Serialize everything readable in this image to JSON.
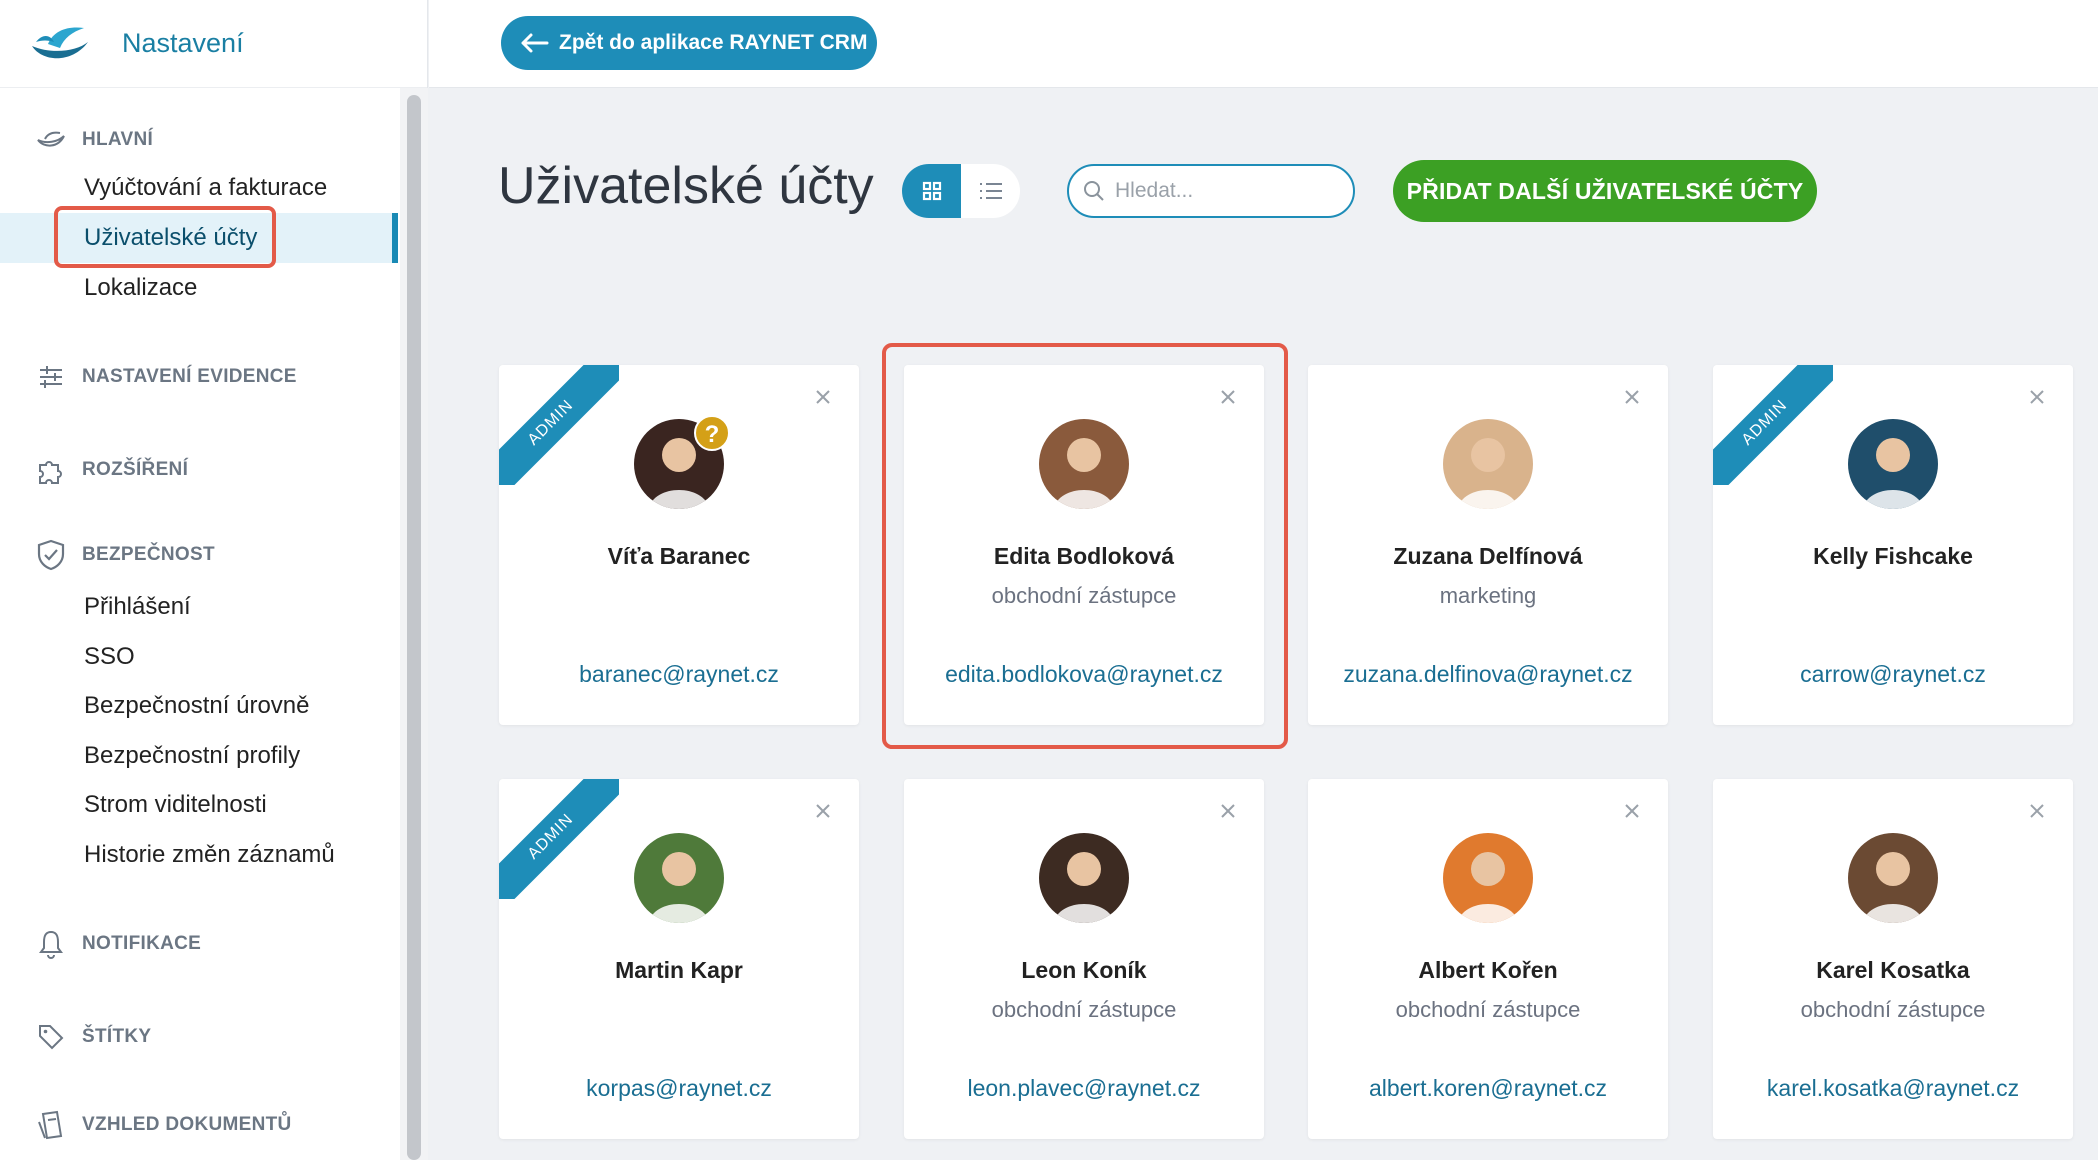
{
  "app": {
    "title": "Nastavení"
  },
  "topbar": {
    "back_label": "Zpět do aplikace RAYNET CRM"
  },
  "sidebar": {
    "sections": [
      {
        "label": "HLAVNÍ",
        "icon": "raynet-logo-icon"
      },
      {
        "label": "NASTAVENÍ EVIDENCE",
        "icon": "sliders-icon"
      },
      {
        "label": "ROZŠÍŘENÍ",
        "icon": "puzzle-icon"
      },
      {
        "label": "BEZPEČNOST",
        "icon": "shield-check-icon"
      },
      {
        "label": "NOTIFIKACE",
        "icon": "bell-icon"
      },
      {
        "label": "ŠTÍTKY",
        "icon": "tag-icon"
      },
      {
        "label": "VZHLED DOKUMENTŮ",
        "icon": "document-style-icon"
      }
    ],
    "main_items": [
      "Vyúčtování a fakturace",
      "Uživatelské účty",
      "Lokalizace"
    ],
    "security_items": [
      "Přihlášení",
      "SSO",
      "Bezpečnostní úrovně",
      "Bezpečnostní profily",
      "Strom viditelnosti",
      "Historie změn záznamů"
    ],
    "active_item": "Uživatelské účty"
  },
  "header": {
    "title": "Uživatelské účty",
    "search_placeholder": "Hledat...",
    "add_button": "PŘIDAT DALŠÍ UŽIVATELSKÉ ÚČTY",
    "view_mode": "grid"
  },
  "users": [
    {
      "name": "Víťa Baranec",
      "role": "",
      "email": "baranec@raynet.cz",
      "admin": true,
      "badge": "?",
      "avatar_color": "#3a2520"
    },
    {
      "name": "Edita Bodloková",
      "role": "obchodní zástupce",
      "email": "edita.bodlokova@raynet.cz",
      "admin": false,
      "badge": "",
      "avatar_color": "#8a5a3c"
    },
    {
      "name": "Zuzana Delfínová",
      "role": "marketing",
      "email": "zuzana.delfinova@raynet.cz",
      "admin": false,
      "badge": "",
      "avatar_color": "#d9b38c"
    },
    {
      "name": "Kelly Fishcake",
      "role": "",
      "email": "carrow@raynet.cz",
      "admin": true,
      "badge": "",
      "avatar_color": "#1f4e6b"
    },
    {
      "name": "Martin Kapr",
      "role": "",
      "email": "korpas@raynet.cz",
      "admin": true,
      "badge": "",
      "avatar_color": "#4f7a3a"
    },
    {
      "name": "Leon Koník",
      "role": "obchodní zástupce",
      "email": "leon.plavec@raynet.cz",
      "admin": false,
      "badge": "",
      "avatar_color": "#3d2b22"
    },
    {
      "name": "Albert Kořen",
      "role": "obchodní zástupce",
      "email": "albert.koren@raynet.cz",
      "admin": false,
      "badge": "",
      "avatar_color": "#e07a2e"
    },
    {
      "name": "Karel Kosatka",
      "role": "obchodní zástupce",
      "email": "karel.kosatka@raynet.cz",
      "admin": false,
      "badge": "",
      "avatar_color": "#6b4a33"
    }
  ],
  "labels": {
    "admin": "ADMIN"
  },
  "colors": {
    "accent": "#1e8db8",
    "add_button": "#3ca024",
    "highlight": "#e35a48"
  }
}
